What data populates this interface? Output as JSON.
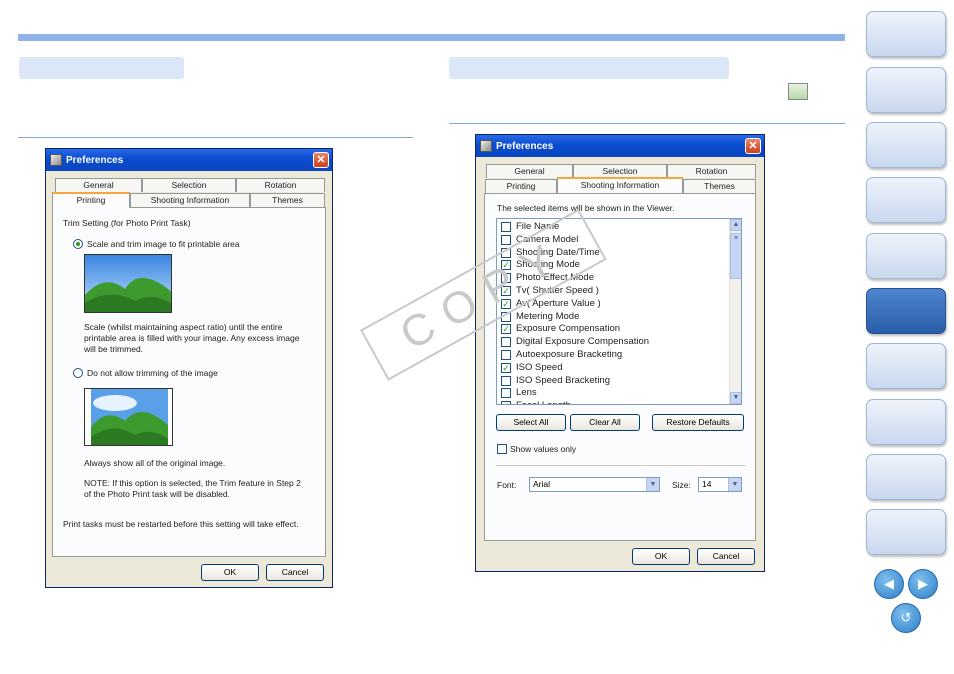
{
  "nav": {
    "prev_icon": "arrow-left-icon",
    "next_icon": "arrow-right-icon",
    "back_icon": "return-icon"
  },
  "watermark": "COPY",
  "left_dialog": {
    "title": "Preferences",
    "close_glyph": "✕",
    "tabs_top": [
      "General",
      "Selection",
      "Rotation"
    ],
    "tabs_bottom": [
      "Printing",
      "Shooting Information",
      "Themes"
    ],
    "group_label": "Trim Setting (for Photo Print Task)",
    "option1": "Scale and trim image to fit printable area",
    "option1_desc": [
      "Scale (whilst maintaining aspect ratio) until the entire",
      "printable area is filled with your image. Any excess image",
      "will be trimmed."
    ],
    "option2": "Do not allow trimming of the image",
    "option2_desc": "Always show all of the original image.",
    "note": [
      "NOTE: If this option is selected, the Trim feature in Step 2",
      "of the Photo Print task will be disabled."
    ],
    "restart_note": "Print tasks must be restarted before this setting will take effect.",
    "ok": "OK",
    "cancel": "Cancel"
  },
  "right_dialog": {
    "title": "Preferences",
    "close_glyph": "✕",
    "tabs_top": [
      "General",
      "Selection",
      "Rotation"
    ],
    "tabs_bottom": [
      "Printing",
      "Shooting Information",
      "Themes"
    ],
    "intro": "The selected items will be shown in the Viewer.",
    "items": [
      {
        "label": "File Name",
        "checked": false
      },
      {
        "label": "Camera Model",
        "checked": false
      },
      {
        "label": "Shooting Date/Time",
        "checked": false
      },
      {
        "label": "Shooting Mode",
        "checked": true
      },
      {
        "label": "Photo Effect Mode",
        "checked": false
      },
      {
        "label": "Tv( Shutter Speed )",
        "checked": true
      },
      {
        "label": "Av( Aperture Value )",
        "checked": true
      },
      {
        "label": "Metering Mode",
        "checked": false
      },
      {
        "label": "Exposure Compensation",
        "checked": true
      },
      {
        "label": "Digital Exposure Compensation",
        "checked": false
      },
      {
        "label": "Autoexposure Bracketing",
        "checked": false
      },
      {
        "label": "ISO Speed",
        "checked": true
      },
      {
        "label": "ISO Speed Bracketing",
        "checked": false
      },
      {
        "label": "Lens",
        "checked": false
      },
      {
        "label": "Focal Length",
        "checked": true
      }
    ],
    "select_all": "Select All",
    "clear_all": "Clear All",
    "restore_defaults": "Restore Defaults",
    "show_values_only": "Show values only",
    "font_label": "Font:",
    "font_value": "Arial",
    "size_label": "Size:",
    "size_value": "14",
    "ok": "OK",
    "cancel": "Cancel"
  }
}
